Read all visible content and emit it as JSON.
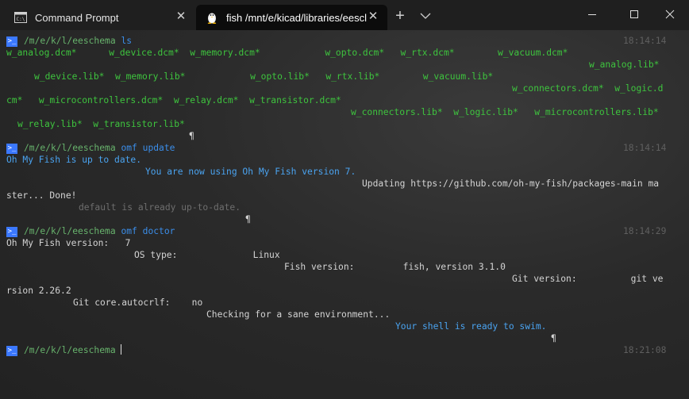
{
  "window": {
    "tabs": [
      {
        "title": "Command Prompt",
        "icon": "cmd-icon"
      },
      {
        "title": "fish /mnt/e/kicad/libraries/eescl",
        "icon": "linux-penguin-icon"
      }
    ]
  },
  "terminal": {
    "path": "/m/e/k/l/eeschema",
    "commands": [
      {
        "cmd": "ls",
        "args": "",
        "time": "18:14:14"
      },
      {
        "cmd": "omf",
        "args": "update",
        "time": "18:14:14"
      },
      {
        "cmd": "omf",
        "args": "doctor",
        "time": "18:14:29"
      },
      {
        "cmd": "",
        "args": "",
        "time": "18:21:08"
      }
    ],
    "ls": {
      "l1": [
        "w_analog.dcm*",
        "w_device.dcm*",
        "w_memory.dcm*",
        "w_opto.dcm*",
        "w_rtx.dcm*",
        "w_vacuum.dcm*"
      ],
      "l2": [
        "w_analog.lib*"
      ],
      "l3": [
        "w_device.lib*",
        "w_memory.lib*",
        "w_opto.lib*",
        "w_rtx.lib*",
        "w_vacuum.lib*"
      ],
      "l4": [
        "w_connectors.dcm*",
        "w_logic.d"
      ],
      "l5": [
        "cm*",
        "w_microcontrollers.dcm*",
        "w_relay.dcm*",
        "w_transistor.dcm*"
      ],
      "l6": [
        "w_connectors.lib*",
        "w_logic.lib*",
        "w_microcontrollers.lib*"
      ],
      "l7": [
        "w_relay.lib*",
        "w_transistor.lib*"
      ]
    },
    "pilcrow": "¶",
    "update": {
      "l1": "Oh My Fish is up to date.",
      "l2": "You are now using Oh My Fish version 7.",
      "l3": "Updating https://github.com/oh-my-fish/packages-main ma",
      "l4": "ster... Done!",
      "l5": "default is already up-to-date."
    },
    "doctor": {
      "omf_label": "Oh My Fish version:",
      "omf_value": "7",
      "os_label": "OS type:",
      "os_value": "Linux",
      "fish_label": "Fish version:",
      "fish_value": "fish, version 3.1.0",
      "git_label": "Git version:",
      "git_value": "git ve",
      "git_cont": "rsion 2.26.2",
      "autocrlf_label": "Git core.autocrlf:",
      "autocrlf_value": "no",
      "checking": "Checking for a sane environment...",
      "ready": "Your shell is ready to swim."
    }
  },
  "colors": {
    "prompt_badge": "#3b78ff",
    "path": "#67b26c",
    "command": "#3b8eea",
    "executable": "#3ec43e",
    "info": "#4aa3f0"
  }
}
